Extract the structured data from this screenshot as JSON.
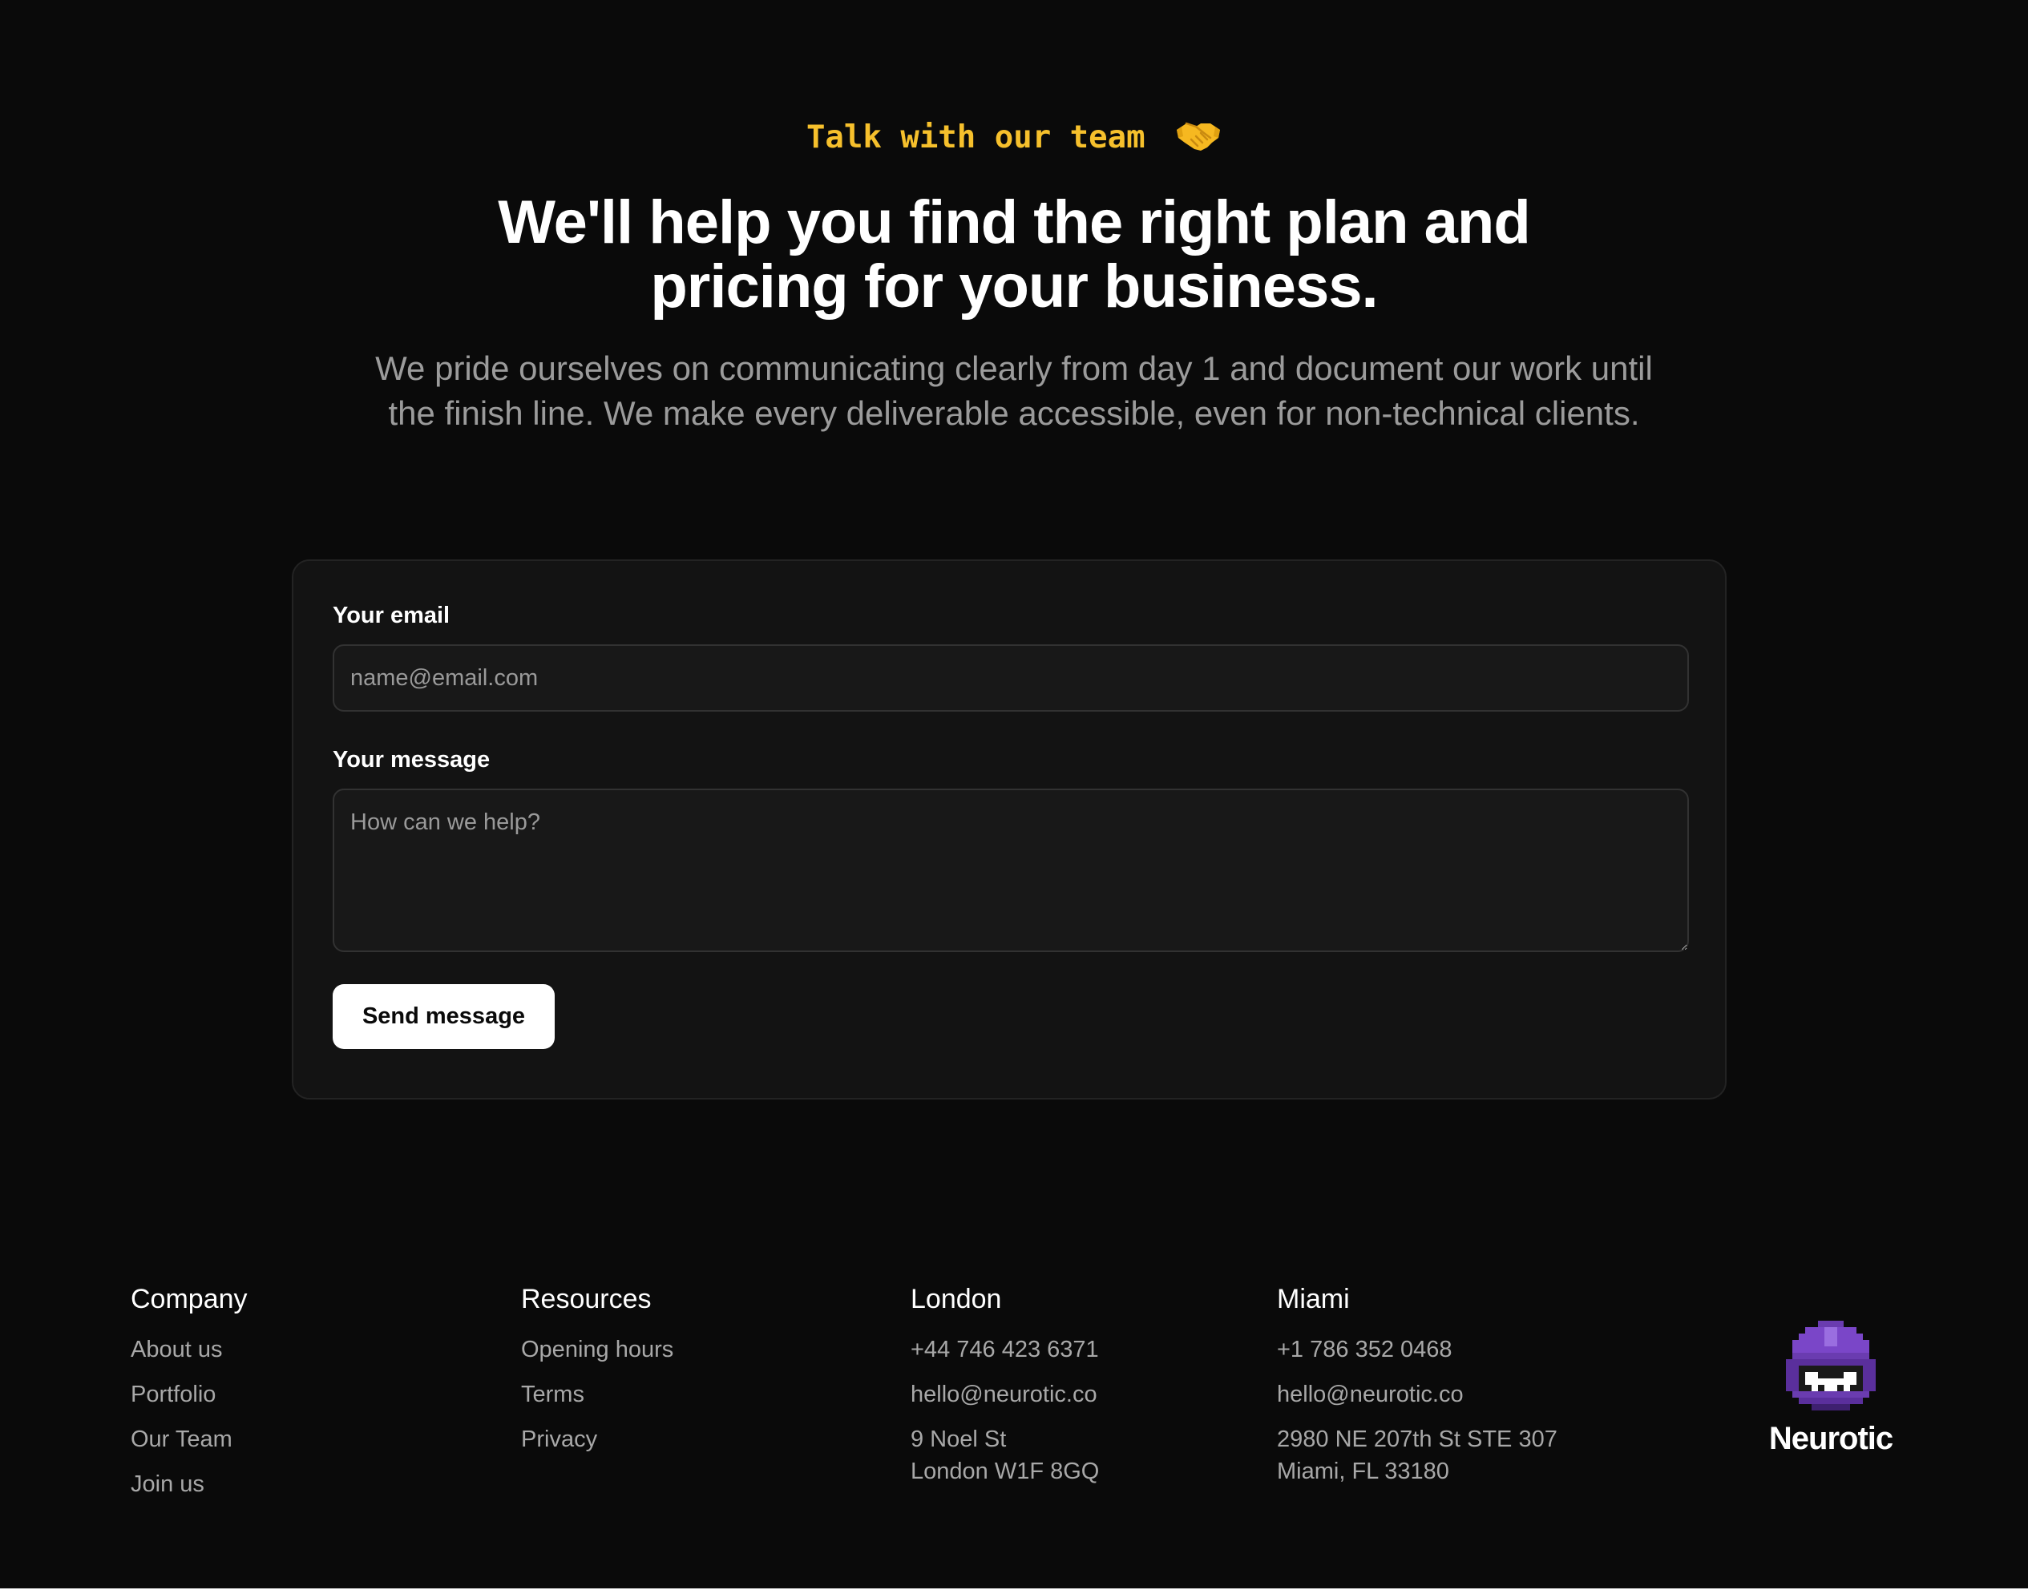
{
  "hero": {
    "eyebrow": "Talk with our team",
    "eyebrow_icon": "handshake-icon",
    "headline_line1": "We'll help you find the right plan and",
    "headline_line2": "pricing for your business.",
    "lede": "We pride ourselves on communicating clearly from day 1 and document our work until the finish line. We make every deliverable accessible, even for non-technical clients."
  },
  "form": {
    "email_label": "Your email",
    "email_placeholder": "name@email.com",
    "email_value": "",
    "message_label": "Your message",
    "message_placeholder": "How can we help?",
    "message_value": "",
    "submit_label": "Send message"
  },
  "footer": {
    "company": {
      "heading": "Company",
      "links": [
        "About us",
        "Portfolio",
        "Our Team",
        "Join us"
      ]
    },
    "resources": {
      "heading": "Resources",
      "links": [
        "Opening hours",
        "Terms",
        "Privacy"
      ]
    },
    "london": {
      "heading": "London",
      "phone": "+44 746 423 6371",
      "email": "hello@neurotic.co",
      "address_line1": "9 Noel St",
      "address_line2": "London W1F 8GQ"
    },
    "miami": {
      "heading": "Miami",
      "phone": "+1 786 352 0468",
      "email": "hello@neurotic.co",
      "address_line1": "2980 NE 207th St STE 307",
      "address_line2": "Miami, FL 33180"
    },
    "brand": {
      "name": "Neurotic",
      "logo_icon": "pixel-helmet-logo"
    }
  },
  "colors": {
    "background": "#0a0a0a",
    "accent": "#f6c02c",
    "card": "#131313",
    "logo_purple": "#7a46c8"
  }
}
